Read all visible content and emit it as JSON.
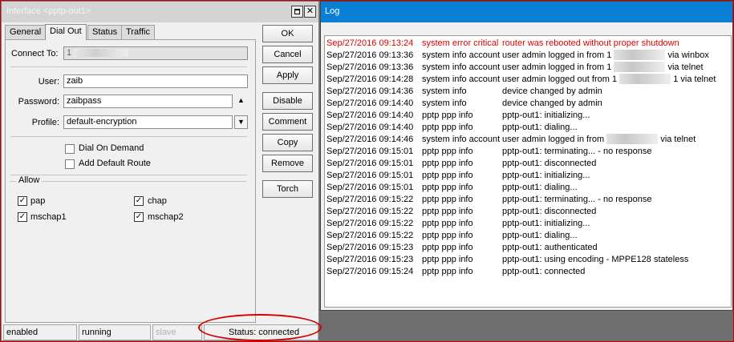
{
  "interface_window": {
    "title": "Interface <pptp-out1>",
    "tabs": [
      "General",
      "Dial Out",
      "Status",
      "Traffic"
    ],
    "connect_to": {
      "label": "Connect To:",
      "value": "1"
    },
    "user": {
      "label": "User:",
      "value": "zaib"
    },
    "password": {
      "label": "Password:",
      "value": "zaibpass"
    },
    "profile": {
      "label": "Profile:",
      "value": "default-encryption"
    },
    "dial_on_demand": {
      "label": "Dial On Demand",
      "checked": false
    },
    "add_default_route": {
      "label": "Add Default Route",
      "checked": false
    },
    "allow": {
      "legend": "Allow",
      "items": [
        {
          "label": "pap",
          "checked": true
        },
        {
          "label": "chap",
          "checked": true
        },
        {
          "label": "mschap1",
          "checked": true
        },
        {
          "label": "mschap2",
          "checked": true
        }
      ]
    },
    "buttons": [
      "OK",
      "Cancel",
      "Apply",
      "Disable",
      "Comment",
      "Copy",
      "Remove",
      "Torch"
    ],
    "statusbar": [
      "enabled",
      "running",
      "slave",
      "Status: connected"
    ]
  },
  "log_window": {
    "title": "Log",
    "error_color": "#e00000",
    "title_color": "#0a7fd6",
    "rows": [
      {
        "time": "Sep/27/2016 09:13:24",
        "topics": "system error critical",
        "message": "router was rebooted without proper shutdown",
        "error": true
      },
      {
        "time": "Sep/27/2016 09:13:36",
        "topics": "system info account",
        "message": "user admin logged in from 1",
        "suffix": "via winbox"
      },
      {
        "time": "Sep/27/2016 09:13:36",
        "topics": "system info account",
        "message": "user admin logged in from 1",
        "suffix": "via telnet"
      },
      {
        "time": "Sep/27/2016 09:14:28",
        "topics": "system info account",
        "message": "user admin logged out from 1",
        "suffix": "1 via telnet"
      },
      {
        "time": "Sep/27/2016 09:14:36",
        "topics": "system info",
        "message": "device changed by admin"
      },
      {
        "time": "Sep/27/2016 09:14:40",
        "topics": "system info",
        "message": "device changed by admin"
      },
      {
        "time": "Sep/27/2016 09:14:40",
        "topics": "pptp ppp info",
        "message": "pptp-out1: initializing..."
      },
      {
        "time": "Sep/27/2016 09:14:40",
        "topics": "pptp ppp info",
        "message": "pptp-out1: dialing..."
      },
      {
        "time": "Sep/27/2016 09:14:46",
        "topics": "system info account",
        "message": "user admin logged in from",
        "suffix": "via telnet"
      },
      {
        "time": "Sep/27/2016 09:15:01",
        "topics": "pptp ppp info",
        "message": "pptp-out1: terminating... - no response"
      },
      {
        "time": "Sep/27/2016 09:15:01",
        "topics": "pptp ppp info",
        "message": "pptp-out1: disconnected"
      },
      {
        "time": "Sep/27/2016 09:15:01",
        "topics": "pptp ppp info",
        "message": "pptp-out1: initializing..."
      },
      {
        "time": "Sep/27/2016 09:15:01",
        "topics": "pptp ppp info",
        "message": "pptp-out1: dialing..."
      },
      {
        "time": "Sep/27/2016 09:15:22",
        "topics": "pptp ppp info",
        "message": "pptp-out1: terminating... - no response"
      },
      {
        "time": "Sep/27/2016 09:15:22",
        "topics": "pptp ppp info",
        "message": "pptp-out1: disconnected"
      },
      {
        "time": "Sep/27/2016 09:15:22",
        "topics": "pptp ppp info",
        "message": "pptp-out1: initializing..."
      },
      {
        "time": "Sep/27/2016 09:15:22",
        "topics": "pptp ppp info",
        "message": "pptp-out1: dialing..."
      },
      {
        "time": "Sep/27/2016 09:15:23",
        "topics": "pptp ppp info",
        "message": "pptp-out1: authenticated"
      },
      {
        "time": "Sep/27/2016 09:15:23",
        "topics": "pptp ppp info",
        "message": "pptp-out1: using encoding - MPPE128 stateless"
      },
      {
        "time": "Sep/27/2016 09:15:24",
        "topics": "pptp ppp info",
        "message": "pptp-out1: connected"
      }
    ]
  },
  "icons": [
    "maximize-icon",
    "close-icon",
    "show-password-icon",
    "dropdown-icon",
    "checkbox-icon"
  ]
}
